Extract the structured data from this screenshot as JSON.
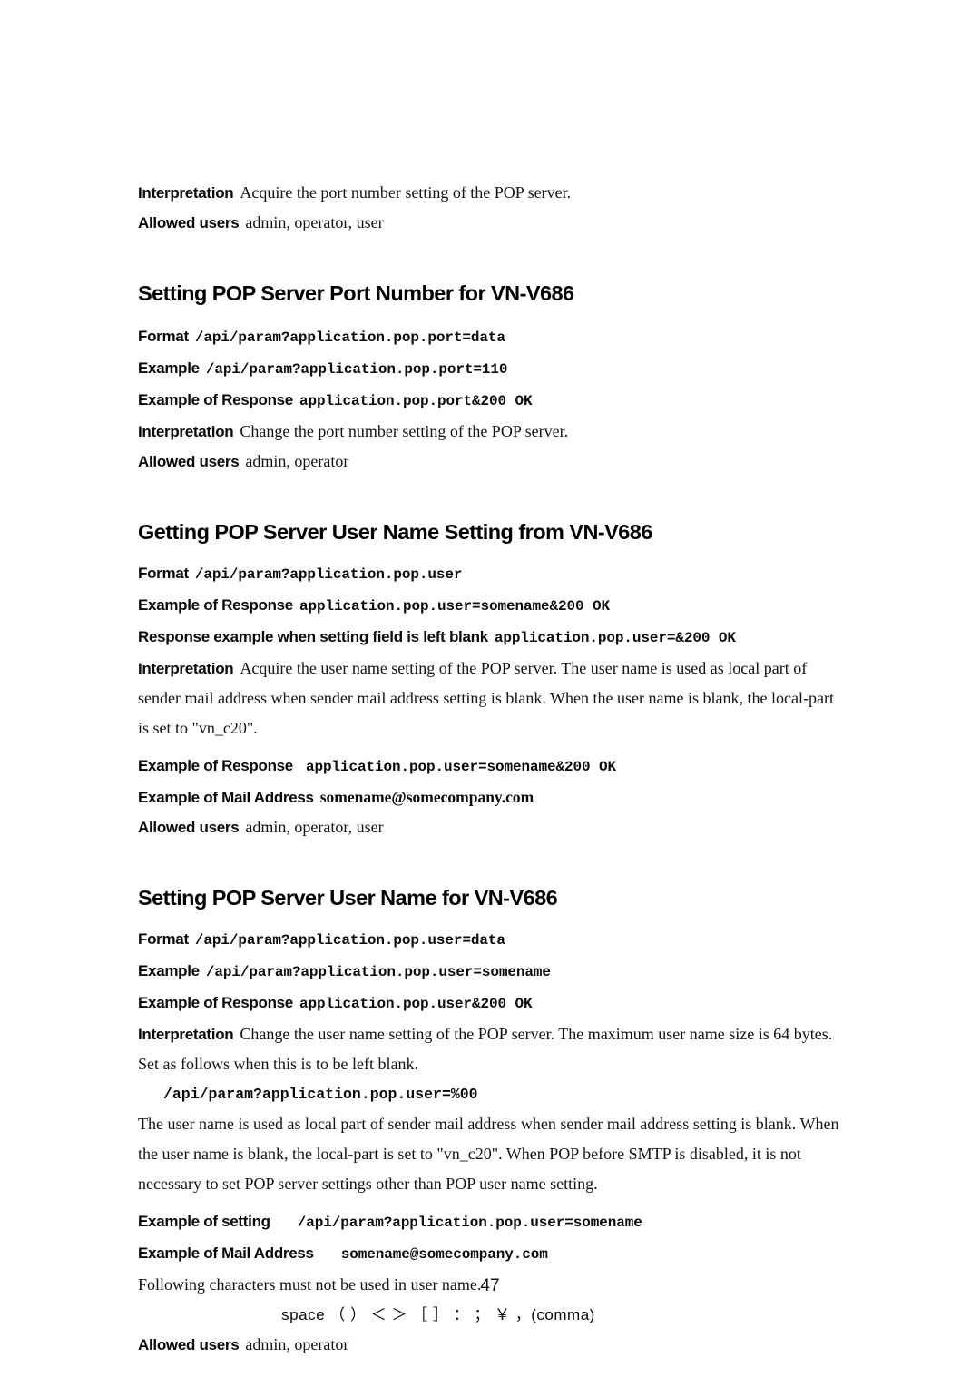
{
  "document": {
    "page_number": "47",
    "background_color": "#ffffff",
    "text_color": "#111111"
  },
  "labels": {
    "interpretation": "Interpretation",
    "allowed_users": "Allowed users",
    "format": "Format",
    "example": "Example",
    "example_of_response": "Example of Response",
    "response_example_blank": "Response example when setting field is left blank",
    "example_of_mail_address": "Example of Mail Address",
    "example_of_setting": "Example of setting"
  },
  "sections": [
    {
      "id": "getting-pop-port-tail",
      "heading": null,
      "rows": [
        {
          "label": "Interpretation",
          "value": "Acquire the port number setting of the POP server.",
          "value_style": "serif"
        },
        {
          "label": "Allowed users",
          "value": "admin, operator, user",
          "value_style": "serif"
        }
      ]
    },
    {
      "id": "setting-pop-port",
      "heading": "Setting POP Server Port Number for VN-V686",
      "rows": [
        {
          "label": "Format",
          "value": "/api/param?application.pop.port=data",
          "value_style": "mono"
        },
        {
          "label": "Example",
          "value": "/api/param?application.pop.port=110",
          "value_style": "mono"
        },
        {
          "label": "Example of Response",
          "value": "application.pop.port&200 OK",
          "value_style": "mono"
        },
        {
          "label": "Interpretation",
          "value": "Change the port number setting of the POP server.",
          "value_style": "serif"
        },
        {
          "label": "Allowed users",
          "value": "admin, operator",
          "value_style": "serif"
        }
      ]
    },
    {
      "id": "getting-pop-user",
      "heading": "Getting POP Server User Name Setting from VN-V686",
      "rows": [
        {
          "label": "Format",
          "value": "/api/param?application.pop.user",
          "value_style": "mono"
        },
        {
          "label": "Example of Response",
          "value": "application.pop.user=somename&200 OK",
          "value_style": "mono"
        },
        {
          "label": "Response example when setting field is left blank",
          "value": "application.pop.user=&200 OK",
          "value_style": "mono"
        }
      ],
      "paragraph": "Acquire the user name setting of the POP server. The user name is used as local part of sender mail address when sender mail address setting is blank. When the user name is blank, the local-part is set to \"vn_c20\".",
      "paragraph_label": "Interpretation",
      "rows_after": [
        {
          "label": "Example of Response",
          "value": "application.pop.user=somename&200 OK",
          "value_style": "mono",
          "wide_gap": true
        },
        {
          "label": "Example of Mail Address",
          "value": "somename@somecompany.com",
          "value_style": "serif-bold"
        },
        {
          "label": "Allowed users",
          "value": "admin, operator, user",
          "value_style": "serif"
        }
      ]
    },
    {
      "id": "setting-pop-user",
      "heading": "Setting POP Server User Name for VN-V686",
      "rows": [
        {
          "label": "Format",
          "value": "/api/param?application.pop.user=data",
          "value_style": "mono"
        },
        {
          "label": "Example",
          "value": "/api/param?application.pop.user=somename",
          "value_style": "mono"
        },
        {
          "label": "Example of Response",
          "value": "application.pop.user&200 OK",
          "value_style": "mono"
        }
      ],
      "paragraph_label": "Interpretation",
      "paragraph": "Change the user name setting of the POP server. The maximum user name size is 64 bytes. Set as follows when this is to be left blank.",
      "code_line": "/api/param?application.pop.user=%00",
      "paragraph_2": "The user name is used as local part of sender mail address when sender mail address setting is blank. When the user name is blank, the local-part is set to \"vn_c20\". When POP before SMTP is disabled, it is not necessary to set POP server settings other than POP user name setting.",
      "rows_after": [
        {
          "label": "Example of setting",
          "value": "/api/param?application.pop.user=somename",
          "value_style": "mono",
          "wide_gap": true
        },
        {
          "label": "Example of Mail Address",
          "value": "somename@somecompany.com",
          "value_style": "mono",
          "wide_gap": true
        }
      ],
      "note": "Following characters must not be used in user name.",
      "forbidden_characters": "space （ ） ＜ ＞ ［ ］ ：  ；  ￥ ，(comma)",
      "allowed_users_row": {
        "label": "Allowed users",
        "value": "admin, operator",
        "value_style": "serif"
      }
    }
  ]
}
